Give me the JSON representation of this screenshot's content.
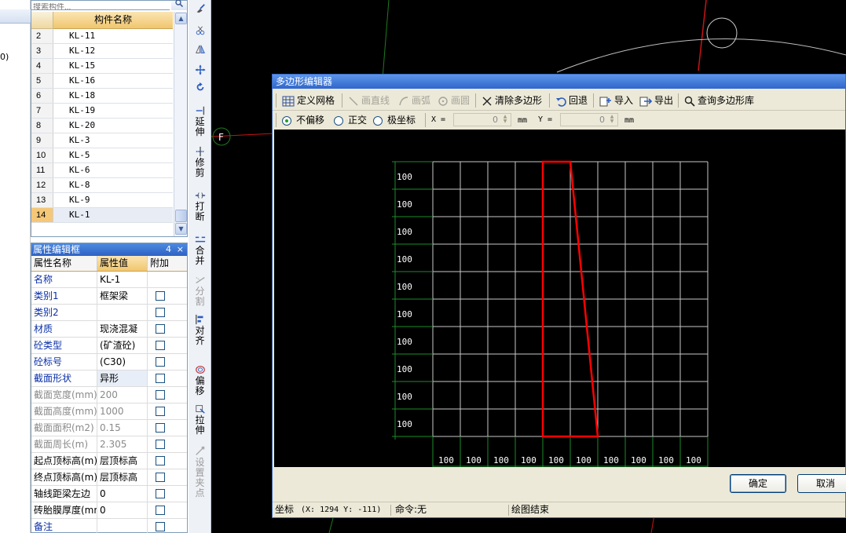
{
  "left_strip": {
    "cut_text": "0)"
  },
  "component_list": {
    "search_placeholder": "搜索构件...",
    "header_name": "构件名称",
    "rows": [
      {
        "num": "2",
        "name": "KL-11"
      },
      {
        "num": "3",
        "name": "KL-12"
      },
      {
        "num": "4",
        "name": "KL-15"
      },
      {
        "num": "5",
        "name": "KL-16"
      },
      {
        "num": "6",
        "name": "KL-18"
      },
      {
        "num": "7",
        "name": "KL-19"
      },
      {
        "num": "8",
        "name": "KL-20"
      },
      {
        "num": "9",
        "name": "KL-3"
      },
      {
        "num": "10",
        "name": "KL-5"
      },
      {
        "num": "11",
        "name": "KL-6"
      },
      {
        "num": "12",
        "name": "KL-8"
      },
      {
        "num": "13",
        "name": "KL-9"
      },
      {
        "num": "14",
        "name": "KL-1"
      }
    ],
    "selected_index": 12
  },
  "property_editor": {
    "title": "属性编辑框",
    "pin": "4",
    "close": "×",
    "col_name": "属性名称",
    "col_value": "属性值",
    "col_extra": "附加",
    "rows": [
      {
        "name": "名称",
        "value": "KL-1",
        "style": "blue",
        "checkbox": false
      },
      {
        "name": "类别1",
        "value": "框架梁",
        "style": "blue",
        "checkbox": true
      },
      {
        "name": "类别2",
        "value": "",
        "style": "blue",
        "checkbox": true
      },
      {
        "name": "材质",
        "value": "现浇混凝",
        "style": "blue",
        "checkbox": true
      },
      {
        "name": "砼类型",
        "value": "(矿渣砼)",
        "style": "blue",
        "checkbox": true
      },
      {
        "name": "砼标号",
        "value": "(C30)",
        "style": "blue",
        "checkbox": true
      },
      {
        "name": "截面形状",
        "value": "异形",
        "style": "blue",
        "checkbox": true
      },
      {
        "name": "截面宽度(mm)",
        "value": "200",
        "style": "gray",
        "checkbox": true
      },
      {
        "name": "截面高度(mm)",
        "value": "1000",
        "style": "gray",
        "checkbox": true
      },
      {
        "name": "截面面积(m2)",
        "value": "0.15",
        "style": "gray",
        "checkbox": true
      },
      {
        "name": "截面周长(m)",
        "value": "2.305",
        "style": "gray",
        "checkbox": true
      },
      {
        "name": "起点顶标高(m)",
        "value": "层顶标高",
        "style": "normal",
        "checkbox": true
      },
      {
        "name": "终点顶标高(m)",
        "value": "层顶标高",
        "style": "normal",
        "checkbox": true
      },
      {
        "name": "轴线距梁左边",
        "value": "0",
        "style": "normal",
        "checkbox": true
      },
      {
        "name": "砖胎膜厚度(mm",
        "value": "0",
        "style": "normal",
        "checkbox": true
      },
      {
        "name": "备注",
        "value": "",
        "style": "blue",
        "checkbox": true
      }
    ]
  },
  "vertical_toolbar": {
    "items": [
      {
        "label": "",
        "icon": "brush-icon"
      },
      {
        "label": "",
        "icon": "scissors-icon"
      },
      {
        "label": "",
        "icon": "mirror-icon"
      },
      {
        "label": "",
        "icon": "move-icon"
      },
      {
        "label": "",
        "icon": "rotate-icon"
      },
      {
        "label": "延伸",
        "icon": "extend-icon"
      },
      {
        "label": "修剪",
        "icon": "trim-icon"
      },
      {
        "label": "打断",
        "icon": "break-icon"
      },
      {
        "label": "合并",
        "icon": "merge-icon"
      },
      {
        "label": "分割",
        "icon": "split-icon",
        "disabled": true
      },
      {
        "label": "对齐",
        "icon": "align-icon"
      },
      {
        "label": "偏移",
        "icon": "offset-icon"
      },
      {
        "label": "拉伸",
        "icon": "stretch-icon"
      },
      {
        "label": "设置夹点",
        "icon": "grip-icon",
        "disabled": true
      }
    ]
  },
  "main_canvas": {
    "axis_label": "F"
  },
  "dialog": {
    "title": "多边形编辑器",
    "toolbar": {
      "define_grid": "定义网格",
      "draw_line": "画直线",
      "draw_arc": "画弧",
      "draw_circle": "画圆",
      "clear_polygon": "清除多边形",
      "undo": "回退",
      "import": "导入",
      "export": "导出",
      "query_library": "查询多边形库"
    },
    "options": {
      "no_offset": "不偏移",
      "orthogonal": "正交",
      "polar": "极坐标",
      "selected": "no_offset"
    },
    "coords": {
      "x_label": "X =",
      "x_value": "0",
      "y_label": "Y =",
      "y_value": "0",
      "unit": "mm"
    },
    "grid": {
      "row_label": "100",
      "col_label": "100",
      "rows": 10,
      "cols": 10,
      "line_color": "#c8c8c8",
      "axis_color": "#1c8c2a",
      "polygon_color": "#ff0000",
      "polygon_cells": [
        [
          4,
          0
        ],
        [
          5,
          0
        ],
        [
          6,
          10
        ],
        [
          4,
          10
        ]
      ]
    },
    "ok": "确定",
    "cancel": "取消",
    "status": {
      "coord_label": "坐标",
      "coord_value": "(X: 1294 Y: -111)",
      "command": "命令:无",
      "message": "绘图结束"
    }
  }
}
